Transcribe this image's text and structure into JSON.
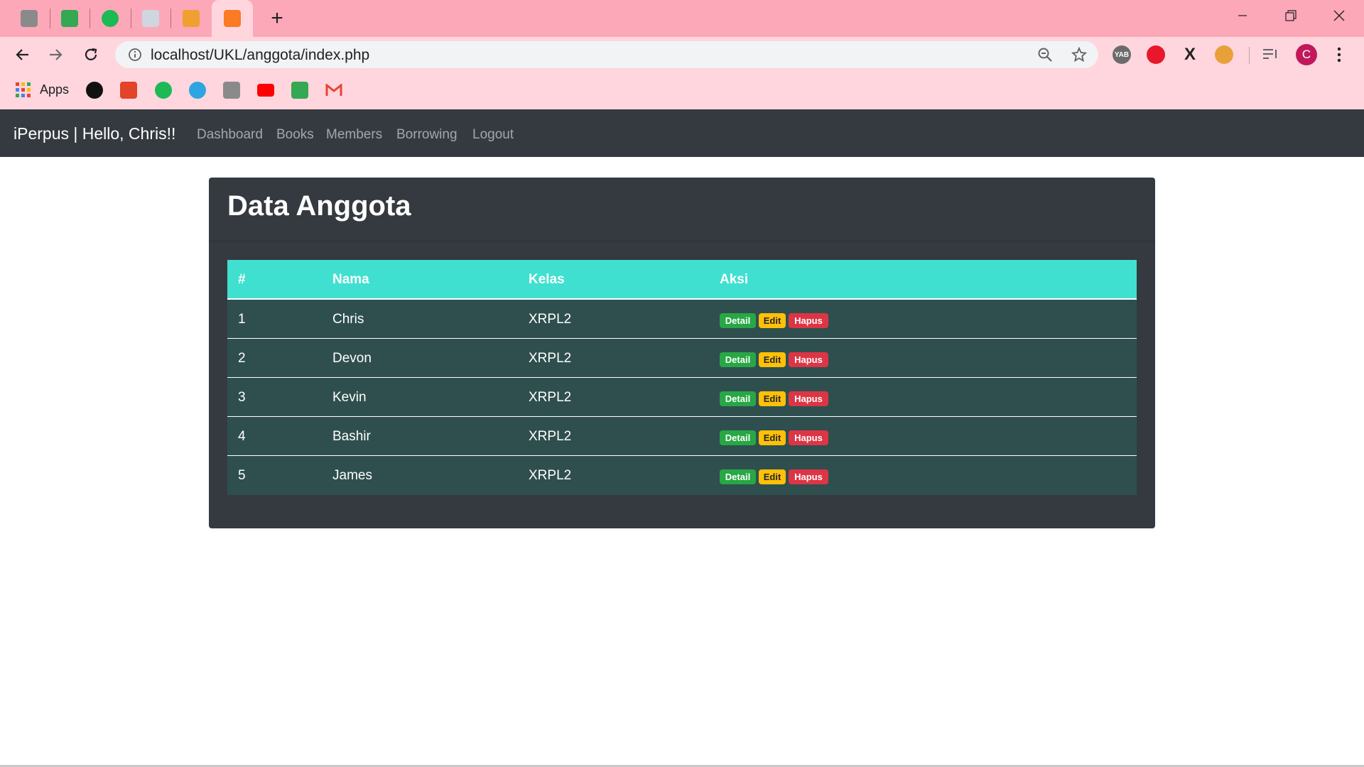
{
  "browser": {
    "tabs": [
      {
        "icon": "photo-tile-icon",
        "active": false
      },
      {
        "icon": "contacts-icon",
        "active": false
      },
      {
        "icon": "timer-30-icon",
        "active": false
      },
      {
        "icon": "book-open-icon",
        "active": false
      },
      {
        "icon": "phpmyadmin-icon",
        "active": false
      },
      {
        "icon": "xampp-icon",
        "active": true
      }
    ],
    "new_tab_symbol": "+",
    "address": "localhost/UKL/anggota/index.php",
    "profile_initial": "C",
    "extensions": [
      {
        "name": "yab-extension-icon",
        "label": "YAB",
        "color": "#6b6b6b"
      },
      {
        "name": "adblock-hand-icon",
        "label": "",
        "color": "#e8172b"
      },
      {
        "name": "x-extension-icon",
        "label": "X",
        "color": "#202124"
      },
      {
        "name": "monkey-extension-icon",
        "label": "",
        "color": "#e8a13a"
      }
    ],
    "bookmarks": {
      "apps_label": "Apps",
      "items": [
        "github-icon",
        "gitlab-icon",
        "timer-30-icon",
        "telegram-icon",
        "photo-tile-icon",
        "youtube-icon",
        "contacts-icon",
        "gmail-icon"
      ]
    }
  },
  "site": {
    "brand": "iPerpus | Hello, Chris!!",
    "nav": [
      "Dashboard",
      "Books",
      "Members",
      "Borrowing",
      "Logout"
    ]
  },
  "card": {
    "title": "Data Anggota",
    "columns": [
      "#",
      "Nama",
      "Kelas",
      "Aksi"
    ],
    "rows": [
      {
        "no": "1",
        "nama": "Chris",
        "kelas": "XRPL2"
      },
      {
        "no": "2",
        "nama": "Devon",
        "kelas": "XRPL2"
      },
      {
        "no": "3",
        "nama": "Kevin",
        "kelas": "XRPL2"
      },
      {
        "no": "4",
        "nama": "Bashir",
        "kelas": "XRPL2"
      },
      {
        "no": "5",
        "nama": "James",
        "kelas": "XRPL2"
      }
    ],
    "actions": {
      "detail": "Detail",
      "edit": "Edit",
      "hapus": "Hapus"
    }
  },
  "colors": {
    "tabstrip": "#fca8b8",
    "navbar": "#343a40",
    "table_head": "#40e0d0",
    "table_row": "#2f4f4f",
    "success": "#28a745",
    "warning": "#ffc107",
    "danger": "#dc3545"
  }
}
